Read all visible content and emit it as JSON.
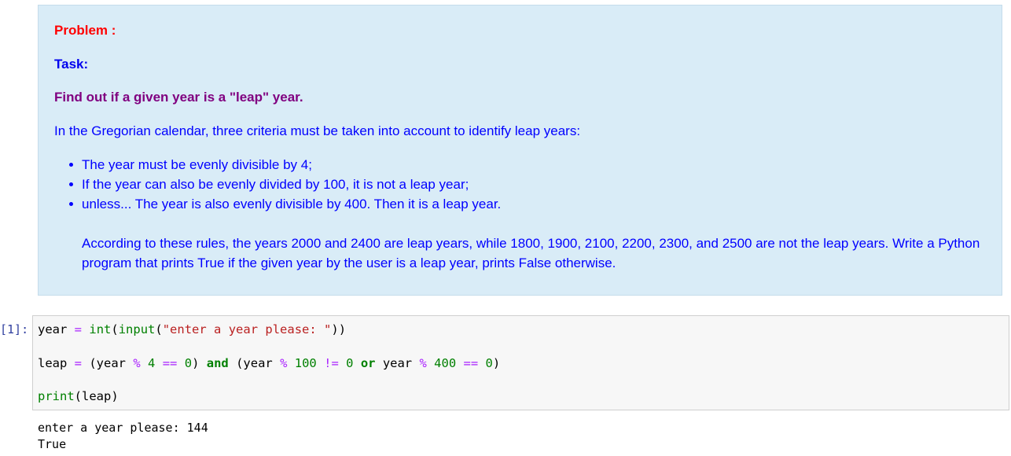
{
  "markdown": {
    "problem": "Problem :",
    "task": "Task:",
    "heading": "Find out if a given year is a \"leap\" year.",
    "intro": "In the Gregorian calendar, three criteria must be taken into account to identify leap years:",
    "bullets": [
      "The year must be evenly divisible by 4;",
      "If the year can also be evenly divided by 100, it is not a leap year;",
      "unless... The year is also evenly divisible by 400. Then it is a leap year."
    ],
    "paragraph": "According to these rules, the years 2000 and 2400 are leap years, while 1800, 1900, 2100, 2200, 2300, and 2500 are not the leap years. Write a Python program that prints True if the given year by the user is a leap year, prints False otherwise."
  },
  "code_cell": {
    "prompt": "[1]:",
    "line1": {
      "var": "year ",
      "eq": "=",
      "sp1": " ",
      "int": "int",
      "p1": "(",
      "input": "input",
      "p2": "(",
      "str": "\"enter a year please: \"",
      "p3": "))"
    },
    "line2": {
      "a": "leap ",
      "eq": "=",
      "b": " (year ",
      "mod1": "%",
      "c": " ",
      "n4": "4",
      "d": " ",
      "eq2": "==",
      "e": " ",
      "z1": "0",
      "f": ") ",
      "and": "and",
      "g": " (year ",
      "mod2": "%",
      "h": " ",
      "n100": "100",
      "i": " ",
      "ne": "!=",
      "j": " ",
      "z2": "0",
      "k": " ",
      "or": "or",
      "l": " year ",
      "mod3": "%",
      "m": " ",
      "n400": "400",
      "n": " ",
      "eq3": "==",
      "o": " ",
      "z3": "0",
      "p": ")"
    },
    "line3": {
      "print": "print",
      "arg": "(leap)"
    }
  },
  "output": {
    "lines": [
      "enter a year please: 144",
      "True"
    ]
  }
}
